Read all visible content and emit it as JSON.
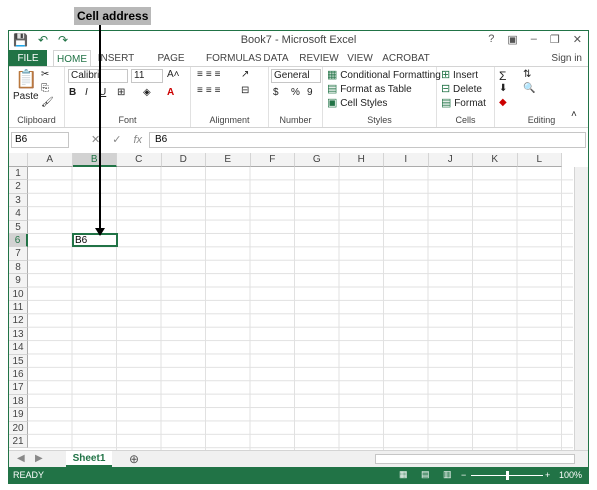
{
  "callout": {
    "label": "Cell address"
  },
  "window": {
    "title": "Book7 - Microsoft Excel",
    "help": "?",
    "minimize": "–",
    "restore": "❐",
    "close": "✕",
    "ribbon_toggle": "▣"
  },
  "qat": {
    "save": "💾",
    "undo": "↶",
    "redo": "↷"
  },
  "tabs": {
    "file": "FILE",
    "home": "HOME",
    "insert": "INSERT",
    "page_layout": "PAGE LAYOUT",
    "formulas": "FORMULAS",
    "data": "DATA",
    "review": "REVIEW",
    "view": "VIEW",
    "acrobat": "ACROBAT",
    "signin": "Sign in"
  },
  "ribbon": {
    "clipboard": {
      "label": "Clipboard",
      "paste": "Paste"
    },
    "font": {
      "label": "Font",
      "name": "Calibri",
      "size": "11",
      "bold": "B",
      "italic": "I",
      "underline": "U"
    },
    "alignment": {
      "label": "Alignment"
    },
    "number": {
      "label": "Number",
      "format": "General",
      "currency": "$",
      "percent": "%",
      "comma": "9"
    },
    "styles": {
      "label": "Styles",
      "conditional": "Conditional Formatting",
      "table": "Format as Table",
      "cell_styles": "Cell Styles"
    },
    "cells": {
      "label": "Cells",
      "insert": "Insert",
      "delete": "Delete",
      "format": "Format"
    },
    "editing": {
      "label": "Editing",
      "sum": "Σ"
    }
  },
  "formula_bar": {
    "name_box": "B6",
    "cancel": "✕",
    "enter": "✓",
    "fx": "fx",
    "value": "B6"
  },
  "grid": {
    "columns": [
      "A",
      "B",
      "C",
      "D",
      "E",
      "F",
      "G",
      "H",
      "I",
      "J",
      "K",
      "L"
    ],
    "rows": [
      "1",
      "2",
      "3",
      "4",
      "5",
      "6",
      "7",
      "8",
      "9",
      "10",
      "11",
      "12",
      "13",
      "14",
      "15",
      "16",
      "17",
      "18",
      "19",
      "20",
      "21"
    ],
    "selected_column": "B",
    "selected_row": "6",
    "active_cell_value": "B6"
  },
  "sheets": {
    "active": "Sheet1",
    "add": "⊕"
  },
  "status": {
    "ready": "READY",
    "zoom": "100%",
    "zoom_minus": "−",
    "zoom_plus": "+"
  },
  "colors": {
    "accent": "#217346"
  }
}
